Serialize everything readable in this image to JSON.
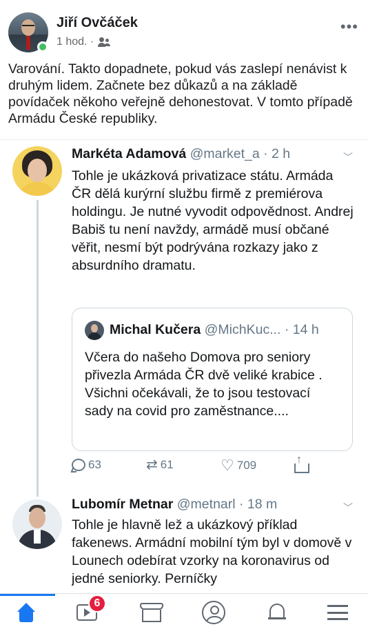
{
  "post": {
    "author": "Jiří Ovčáček",
    "time": "1 hod. ·",
    "text": "Varování. Takto dopadnete, pokud vás zaslepí nenávist k druhým lidem. Začnete bez důkazů a na základě povídaček někoho veřejně dehonestovat. V tomto případě Armádu České republiky."
  },
  "tweets": [
    {
      "name": "Markéta Adamová",
      "handle": "@market_a · 2 h",
      "text": "Tohle je ukázková privatizace státu. Armáda ČR dělá kurýrní službu firmě z premiérova holdingu. Je nutné vyvodit odpovědnost. Andrej Babiš tu není navždy, armádě musí občané věřit, nesmí být podrývána rozkazy jako z absurdního dramatu.",
      "quote": {
        "name": "Michal Kučera",
        "handle": "@MichKuc... · 14 h",
        "text": "Včera do našeho Domova pro seniory přivezla Armáda ČR  dvě veliké krabice . Všichni očekávali, že to jsou testovací sady na covid pro zaměstnance...."
      },
      "replies": "63",
      "retweets": "61",
      "likes": "709"
    },
    {
      "name": "Lubomír Metnar",
      "handle": "@metnarl · 18 m",
      "text": "Tohle je hlavně lež a ukázkový příklad fakenews. Armádní mobilní tým byl v domově v Lounech odebírat vzorky na koronavirus od jedné seniorky. Perníčky"
    }
  ],
  "nav": {
    "watch_badge": "6"
  },
  "colors": {
    "facebook_blue": "#1877f2",
    "badge_red": "#e41e3f",
    "online_green": "#45bd62"
  }
}
